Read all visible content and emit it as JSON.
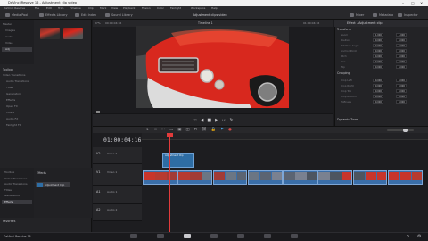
{
  "window": {
    "title": "DaVinci Resolve 16 - Adjustment clip video"
  },
  "menu": [
    "DaVinci Resolve",
    "File",
    "Edit",
    "Trim",
    "Timeline",
    "Clip",
    "Mark",
    "View",
    "Playback",
    "Fusion",
    "Color",
    "Fairlight",
    "Workspace",
    "Help"
  ],
  "toolbar": {
    "left": [
      "Media Pool",
      "Effects Library",
      "Edit Index",
      "Sound Library"
    ],
    "center_title": "Adjustment clips video",
    "right": [
      "Mixer",
      "Metadata",
      "Inspector"
    ],
    "zoom": "37%",
    "timecode_top": "00:00:04:16",
    "timeline_name": "Timeline 1",
    "viewer_tc": "01:00:04:16",
    "viewer_fit": "Fit"
  },
  "left_panel": {
    "tree": [
      "Master",
      "Images",
      "Audio",
      "Video",
      "Adj"
    ],
    "selected": "Adj",
    "section": "Toolbox",
    "fx_items": [
      "Video Transitions",
      "Audio Transitions",
      "Titles",
      "Generators",
      "Effects",
      "Open FX",
      "Filters",
      "Audio FX",
      "Fairlight FX"
    ],
    "generators_list": [
      "Adjustment Clip"
    ],
    "favorites": "Favorites",
    "lower_tree": [
      "Toolbox",
      "Video Transitions",
      "Audio Transitions",
      "Titles",
      "Generators",
      "Effects"
    ],
    "lower_selected": "Effects"
  },
  "inspector": {
    "header": "Effect - Adjustment clip",
    "sections": [
      "Transform",
      "Cropping",
      "Dynamic Zoom"
    ],
    "rows": [
      "Zoom",
      "Position",
      "Rotation Angle",
      "Anchor Point",
      "Pitch",
      "Yaw",
      "Flip"
    ],
    "values": [
      "1.000",
      "0.000",
      "0.000",
      "0.000",
      "0.000",
      "0.000",
      "0.000"
    ],
    "crop_rows": [
      "Crop Left",
      "Crop Right",
      "Crop Top",
      "Crop Bottom",
      "Softness"
    ],
    "crop_values": [
      "0.000",
      "0.000",
      "0.000",
      "0.000",
      "0.000"
    ]
  },
  "timeline": {
    "timecode": "01:00:04:16",
    "tracks": [
      {
        "id": "V2",
        "name": "Video 2"
      },
      {
        "id": "V1",
        "name": "Video 1"
      },
      {
        "id": "A1",
        "name": "Audio 1"
      },
      {
        "id": "A2",
        "name": "Audio 2"
      }
    ],
    "adjustment_clip_label": "Adjustment Clip",
    "clips": [
      "Red Car",
      "Red Car",
      "Mustang",
      "Street",
      "Street",
      "Street",
      "Truck",
      "Red Car"
    ]
  },
  "status": {
    "app": "DaVinci Resolve 16"
  },
  "colors": {
    "accent": "#2e6da4",
    "playhead": "#e23b3b",
    "car_red": "#d8281e"
  }
}
